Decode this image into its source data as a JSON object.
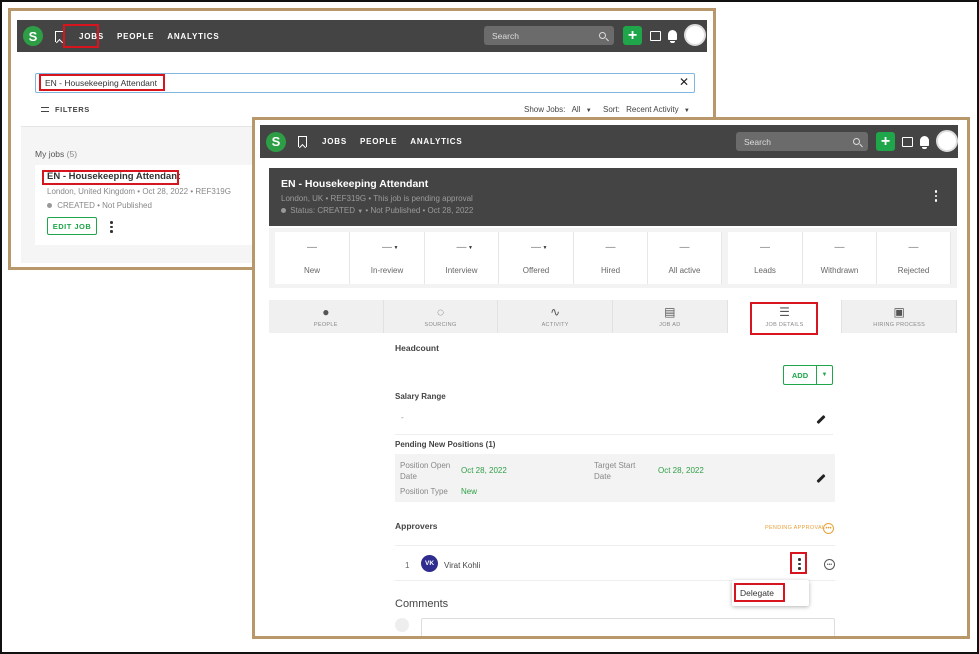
{
  "window1": {
    "nav": [
      "JOBS",
      "PEOPLE",
      "ANALYTICS"
    ],
    "logo": "S",
    "search_placeholder": "Search",
    "search_value": "EN - Housekeeping Attendant",
    "filters": "FILTERS",
    "show_jobs_label": "Show Jobs:",
    "show_jobs_value": "All",
    "sort_label": "Sort:",
    "sort_value": "Recent Activity",
    "my_jobs": "My jobs",
    "my_jobs_count": "(5)",
    "job": {
      "title": "EN - Housekeeping Attendant",
      "location": "London, United Kingdom",
      "date": "Oct 28, 2022",
      "ref": "REF319G",
      "status": "CREATED",
      "publish": "Not Published",
      "edit_button": "EDIT JOB"
    }
  },
  "window2": {
    "nav": [
      "JOBS",
      "PEOPLE",
      "ANALYTICS"
    ],
    "logo": "S",
    "search_placeholder": "Search",
    "job_title": "EN - Housekeeping Attendant",
    "job_location": "London, UK",
    "job_ref": "REF319G",
    "job_pending": "This job is pending approval",
    "status_label": "Status:",
    "status_value": "CREATED",
    "publish": "Not Published",
    "date": "Oct 28, 2022",
    "pipeline": [
      {
        "value": "—",
        "label": "New"
      },
      {
        "value": "—",
        "label": "In-review"
      },
      {
        "value": "—",
        "label": "Interview"
      },
      {
        "value": "—",
        "label": "Offered"
      },
      {
        "value": "—",
        "label": "Hired"
      },
      {
        "value": "—",
        "label": "All active"
      },
      {
        "value": "—",
        "label": "Leads"
      },
      {
        "value": "—",
        "label": "Withdrawn"
      },
      {
        "value": "—",
        "label": "Rejected"
      }
    ],
    "tabs": [
      {
        "label": "PEOPLE",
        "icon": "person-icon"
      },
      {
        "label": "SOURCING",
        "icon": "sourcing-icon"
      },
      {
        "label": "ACTIVITY",
        "icon": "activity-icon"
      },
      {
        "label": "JOB AD",
        "icon": "document-icon"
      },
      {
        "label": "JOB DETAILS",
        "icon": "sliders-icon"
      },
      {
        "label": "HIRING PROCESS",
        "icon": "id-card-icon"
      }
    ],
    "headcount": "Headcount",
    "add_button": "ADD",
    "salary_range": "Salary Range",
    "salary_value": "-",
    "pending_positions": "Pending New Positions (1)",
    "position_open_date_label": "Position Open Date",
    "position_open_date": "Oct 28, 2022",
    "target_start_date_label": "Target Start Date",
    "target_start_date": "Oct 28, 2022",
    "position_type_label": "Position Type",
    "position_type": "New",
    "approvers": "Approvers",
    "pending_approval": "PENDING APPROVAL",
    "approver": {
      "index": "1",
      "initials": "VK",
      "name": "Virat Kohli"
    },
    "delegate": "Delegate",
    "comments": "Comments"
  },
  "colors": {
    "accent_green": "#1fa64a",
    "highlight_red": "#d8141f",
    "frame_tan": "#b8976a",
    "topbar": "#444444",
    "pending_orange": "#e8a23c",
    "avatar_indigo": "#2f2c8f"
  }
}
